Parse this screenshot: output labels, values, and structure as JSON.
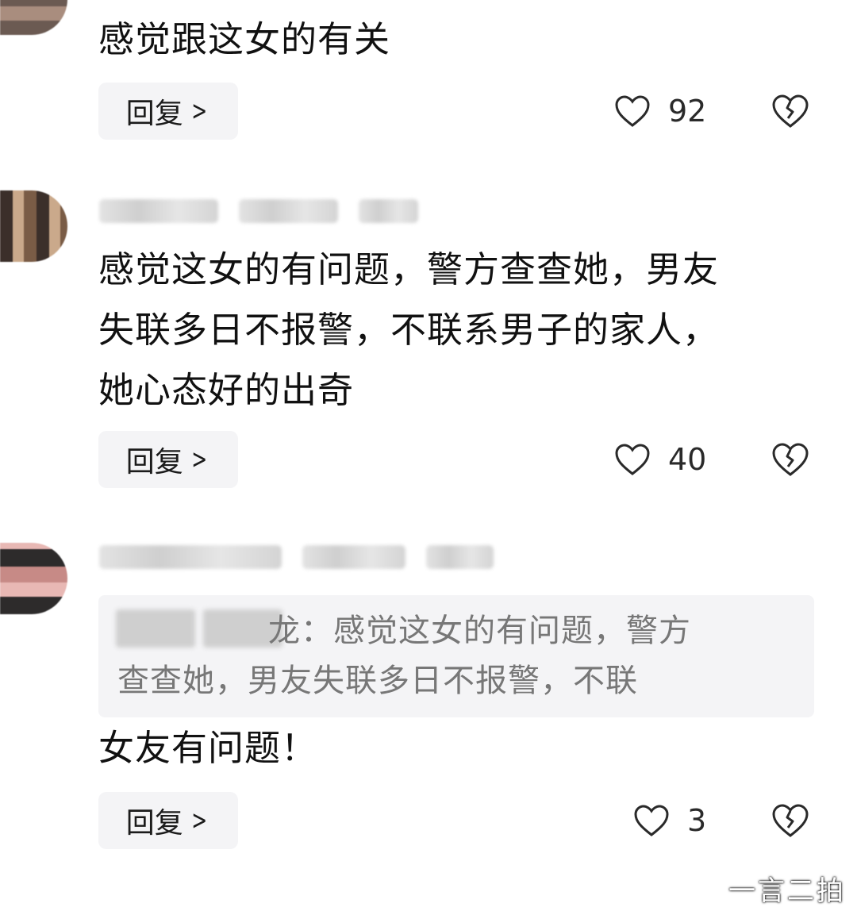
{
  "comments": [
    {
      "text": "感觉跟这女的有关",
      "reply_label": "回复",
      "likes": "92"
    },
    {
      "text": "感觉这女的有问题，警方查查她，男友\n失联多日不报警，不联系男子的家人，\n她心态好的出奇",
      "reply_label": "回复",
      "likes": "40"
    },
    {
      "quote": "龙：感觉这女的有问题，警方查查她，男友查查她，男友失联多日不报警，不联",
      "quote_visible_line1": "龙：感觉这女的有问题，警方",
      "quote_visible_line2": "查查她，男友失联多日不报警，不联",
      "text": "女友有问题！",
      "reply_label": "回复",
      "likes": "3"
    }
  ],
  "icons": {
    "like": "heart-outline-icon",
    "dislike": "broken-heart-icon",
    "reply_chevron": "chevron-right-icon"
  },
  "watermark": "一言二拍"
}
